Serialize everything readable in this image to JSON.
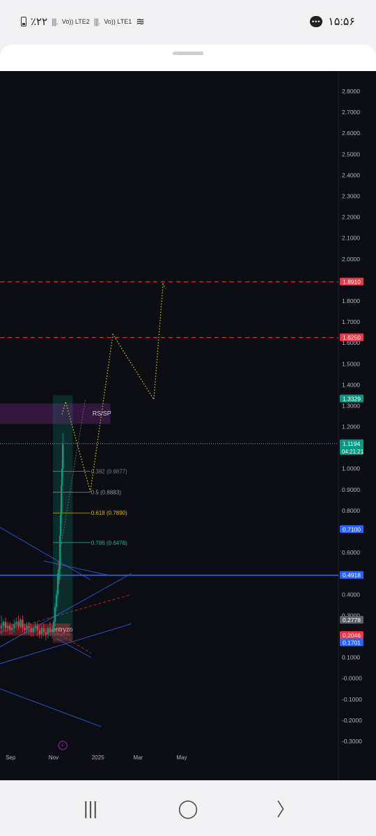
{
  "status_bar": {
    "battery": "٪۲۲",
    "sim2": "Vo)) LTE2",
    "sim1": "Vo)) LTE1",
    "time": "۱۵:۵۶"
  },
  "nav": {
    "recents": "|||",
    "home": "◯",
    "back": "〉"
  },
  "chart_data": {
    "type": "candlestick",
    "ylim": [
      -0.35,
      2.85
    ],
    "y_ticks": [
      "2.8000",
      "2.7000",
      "2.6000",
      "2.5000",
      "2.4000",
      "2.3000",
      "2.2000",
      "2.1000",
      "2.0000",
      "1.9000",
      "1.8000",
      "1.7000",
      "1.6000",
      "1.5000",
      "1.4000",
      "1.3000",
      "1.2000",
      "1.0000",
      "0.9000",
      "0.8000",
      "0.6000",
      "0.4000",
      "0.3000",
      "0.1000",
      "-0.0000",
      "-0.1000",
      "-0.2000",
      "-0.3000"
    ],
    "x_ticks": [
      {
        "label": "Sep",
        "t": 0
      },
      {
        "label": "Nov",
        "t": 61
      },
      {
        "label": "2025",
        "t": 122
      },
      {
        "label": "Mar",
        "t": 181
      },
      {
        "label": "May",
        "t": 242
      }
    ],
    "x_range": [
      -6,
      290
    ],
    "price_labels": [
      {
        "text": "1.8910",
        "value": 1.891,
        "color": "#f23645"
      },
      {
        "text": "1.6250",
        "value": 1.625,
        "color": "#f23645"
      },
      {
        "text": "1.3329",
        "value": 1.3329,
        "color": "#089981"
      },
      {
        "text": "1.1194",
        "value": 1.1194,
        "color": "#089981",
        "sub": "04:21:21"
      },
      {
        "text": "0.7100",
        "value": 0.71,
        "color": "#2962ff"
      },
      {
        "text": "0.4918",
        "value": 0.4918,
        "color": "#2962ff"
      },
      {
        "text": "0.2778",
        "value": 0.2778,
        "color": "#5d606b"
      },
      {
        "text": "0.2046",
        "value": 0.2046,
        "color": "#f23645"
      },
      {
        "text": "0.1701",
        "value": 0.1701,
        "color": "#2962ff"
      }
    ],
    "horizontal_lines": [
      {
        "value": 1.891,
        "color": "#f23645",
        "dash": true
      },
      {
        "value": 1.625,
        "color": "#f23645",
        "dash": true
      },
      {
        "value": 1.1194,
        "color": "#9598a1",
        "dash": true
      },
      {
        "value": 0.4918,
        "color": "#2962ff",
        "dash": false
      }
    ],
    "fib_levels": [
      {
        "label": "0.382 (0.9877)",
        "value": 0.9877,
        "color": "#787b86"
      },
      {
        "label": "0.5 (0.8883)",
        "value": 0.8883,
        "color": "#9598a1"
      },
      {
        "label": "0.618 (0.7890)",
        "value": 0.789,
        "color": "#d4b700"
      },
      {
        "label": "0.786 (0.6476)",
        "value": 0.6476,
        "color": "#22ab94"
      }
    ],
    "zones": [
      {
        "label": "RS/SP",
        "t_start": -6,
        "t_end": 150,
        "y_low": 1.215,
        "y_high": 1.31,
        "color": "#7b2d8e"
      },
      {
        "label": "entryzo",
        "t_start": -6,
        "t_end": 93,
        "y_low": 0.205,
        "y_high": 0.26,
        "color": "#f23645"
      }
    ],
    "projection_path": [
      {
        "t": 82,
        "v": 1.26
      },
      {
        "t": 87,
        "v": 1.32
      },
      {
        "t": 122,
        "v": 0.89
      },
      {
        "t": 154,
        "v": 1.64
      },
      {
        "t": 212,
        "v": 1.33
      },
      {
        "t": 225,
        "v": 1.88
      },
      {
        "t": 229,
        "v": 1.86
      }
    ],
    "candles": [
      {
        "t": -4,
        "o": 0.24,
        "h": 0.3,
        "c": 0.25,
        "l": 0.21
      },
      {
        "t": -1,
        "o": 0.25,
        "h": 0.28,
        "c": 0.27,
        "l": 0.22
      },
      {
        "t": 2,
        "o": 0.27,
        "h": 0.29,
        "c": 0.24,
        "l": 0.22
      },
      {
        "t": 5,
        "o": 0.24,
        "h": 0.27,
        "c": 0.25,
        "l": 0.22
      },
      {
        "t": 8,
        "o": 0.25,
        "h": 0.27,
        "c": 0.23,
        "l": 0.21
      },
      {
        "t": 11,
        "o": 0.23,
        "h": 0.26,
        "c": 0.24,
        "l": 0.21
      },
      {
        "t": 14,
        "o": 0.24,
        "h": 0.28,
        "c": 0.26,
        "l": 0.22
      },
      {
        "t": 17,
        "o": 0.26,
        "h": 0.29,
        "c": 0.27,
        "l": 0.24
      },
      {
        "t": 20,
        "o": 0.27,
        "h": 0.3,
        "c": 0.25,
        "l": 0.23
      },
      {
        "t": 23,
        "o": 0.25,
        "h": 0.29,
        "c": 0.28,
        "l": 0.24
      },
      {
        "t": 26,
        "o": 0.28,
        "h": 0.3,
        "c": 0.24,
        "l": 0.22
      },
      {
        "t": 29,
        "o": 0.24,
        "h": 0.26,
        "c": 0.23,
        "l": 0.21
      },
      {
        "t": 32,
        "o": 0.23,
        "h": 0.27,
        "c": 0.25,
        "l": 0.21
      },
      {
        "t": 35,
        "o": 0.25,
        "h": 0.27,
        "c": 0.24,
        "l": 0.21
      },
      {
        "t": 38,
        "o": 0.24,
        "h": 0.26,
        "c": 0.22,
        "l": 0.2
      },
      {
        "t": 41,
        "o": 0.22,
        "h": 0.25,
        "c": 0.24,
        "l": 0.2
      },
      {
        "t": 44,
        "o": 0.24,
        "h": 0.27,
        "c": 0.25,
        "l": 0.22
      },
      {
        "t": 47,
        "o": 0.25,
        "h": 0.27,
        "c": 0.23,
        "l": 0.2
      },
      {
        "t": 50,
        "o": 0.23,
        "h": 0.25,
        "c": 0.21,
        "l": 0.19
      },
      {
        "t": 53,
        "o": 0.21,
        "h": 0.25,
        "c": 0.24,
        "l": 0.19
      },
      {
        "t": 56,
        "o": 0.24,
        "h": 0.26,
        "c": 0.22,
        "l": 0.2
      },
      {
        "t": 59,
        "o": 0.22,
        "h": 0.24,
        "c": 0.21,
        "l": 0.18
      },
      {
        "t": 62,
        "o": 0.21,
        "h": 0.25,
        "c": 0.24,
        "l": 0.19
      },
      {
        "t": 65,
        "o": 0.24,
        "h": 0.27,
        "c": 0.22,
        "l": 0.2
      },
      {
        "t": 68,
        "o": 0.22,
        "h": 0.25,
        "c": 0.23,
        "l": 0.19
      },
      {
        "t": 70,
        "o": 0.23,
        "h": 0.28,
        "c": 0.27,
        "l": 0.21
      },
      {
        "t": 72,
        "o": 0.27,
        "h": 0.36,
        "c": 0.34,
        "l": 0.25
      },
      {
        "t": 74,
        "o": 0.34,
        "h": 0.42,
        "c": 0.4,
        "l": 0.32
      },
      {
        "t": 76,
        "o": 0.4,
        "h": 0.52,
        "c": 0.5,
        "l": 0.38
      },
      {
        "t": 77,
        "o": 0.5,
        "h": 0.56,
        "c": 0.47,
        "l": 0.44
      },
      {
        "t": 78,
        "o": 0.47,
        "h": 0.55,
        "c": 0.52,
        "l": 0.45
      },
      {
        "t": 79,
        "o": 0.52,
        "h": 0.72,
        "c": 0.68,
        "l": 0.5
      },
      {
        "t": 80,
        "o": 0.68,
        "h": 0.82,
        "c": 0.78,
        "l": 0.64
      },
      {
        "t": 81,
        "o": 0.78,
        "h": 0.95,
        "c": 0.92,
        "l": 0.74
      },
      {
        "t": 82,
        "o": 0.92,
        "h": 1.04,
        "c": 1.0,
        "l": 0.88
      },
      {
        "t": 83,
        "o": 1.0,
        "h": 1.17,
        "c": 1.12,
        "l": 0.96
      }
    ]
  }
}
